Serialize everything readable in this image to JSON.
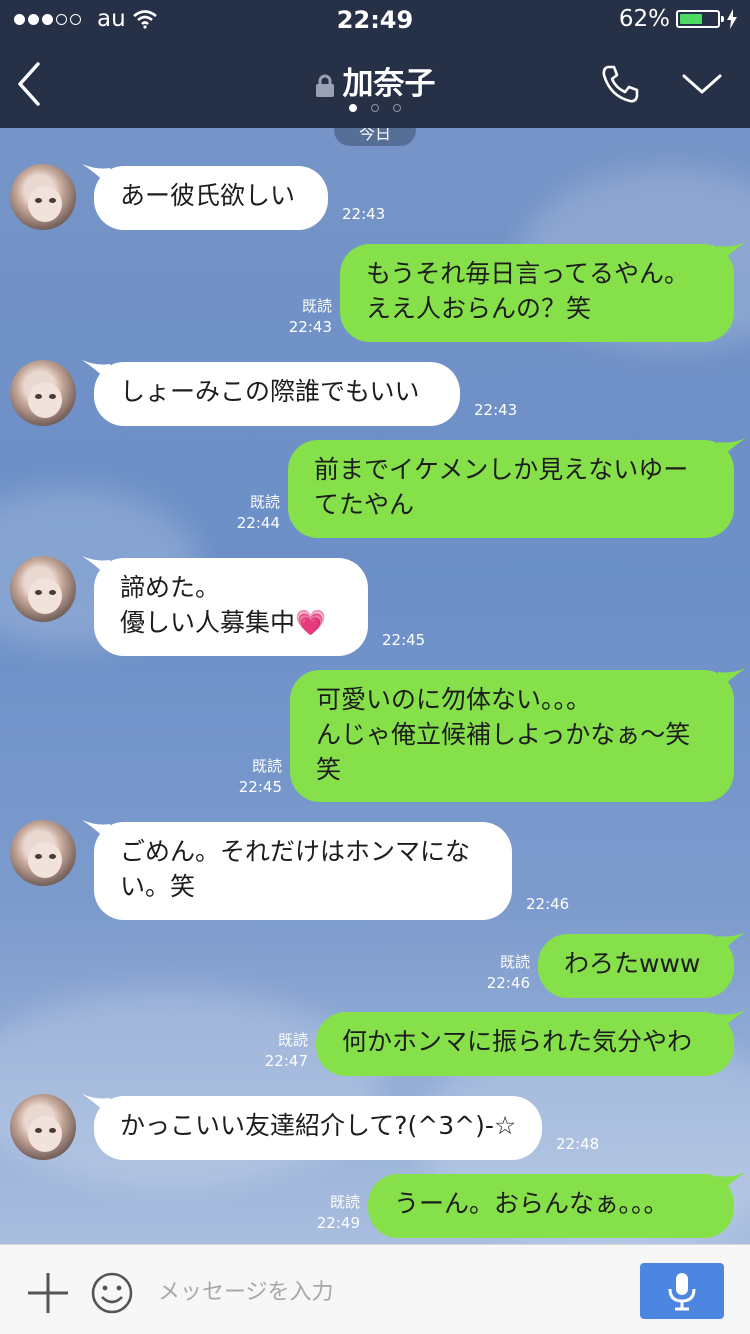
{
  "status_bar": {
    "signal_bars_on": 3,
    "signal_bars_total": 5,
    "carrier": "au",
    "time": "22:49",
    "battery_percent": "62%",
    "battery_level": 0.62
  },
  "header": {
    "title": "加奈子",
    "page_dots": 3,
    "active_dot": 0
  },
  "chat": {
    "date_label": "今日",
    "messages": [
      {
        "side": "in",
        "lines": [
          "あー彼氏欲しい"
        ],
        "time": "22:43",
        "read": ""
      },
      {
        "side": "out",
        "lines": [
          "もうそれ毎日言ってるやん。",
          "ええ人おらんの？笑"
        ],
        "time": "22:43",
        "read": "既読"
      },
      {
        "side": "in",
        "lines": [
          "しょーみこの際誰でもいい"
        ],
        "time": "22:43",
        "read": ""
      },
      {
        "side": "out",
        "lines": [
          "前までイケメンしか見えないゆー",
          "てたやん"
        ],
        "time": "22:44",
        "read": "既読"
      },
      {
        "side": "in",
        "lines": [
          "諦めた。",
          "優しい人募集中💗"
        ],
        "time": "22:45",
        "read": ""
      },
      {
        "side": "out",
        "lines": [
          "可愛いのに勿体ない。。。",
          "んじゃ俺立候補しよっかなぁ〜笑",
          "笑"
        ],
        "time": "22:45",
        "read": "既読"
      },
      {
        "side": "in",
        "lines": [
          "ごめん。それだけはホンマにな",
          "い。笑"
        ],
        "time": "22:46",
        "read": ""
      },
      {
        "side": "out",
        "lines": [
          "わろたwww"
        ],
        "time": "22:46",
        "read": "既読"
      },
      {
        "side": "out",
        "lines": [
          "何かホンマに振られた気分やわ"
        ],
        "time": "22:47",
        "read": "既読"
      },
      {
        "side": "in",
        "lines": [
          "かっこいい友達紹介して?(^3^)-☆"
        ],
        "time": "22:48",
        "read": ""
      },
      {
        "side": "out",
        "lines": [
          "うーん。おらんなぁ。。。"
        ],
        "time": "22:49",
        "read": "既読"
      }
    ]
  },
  "input": {
    "placeholder": "メッセージを入力"
  },
  "colors": {
    "header_bg": "#263047",
    "outgoing_bubble": "#86e04a",
    "incoming_bubble": "#ffffff",
    "mic_button": "#4c86e0"
  }
}
